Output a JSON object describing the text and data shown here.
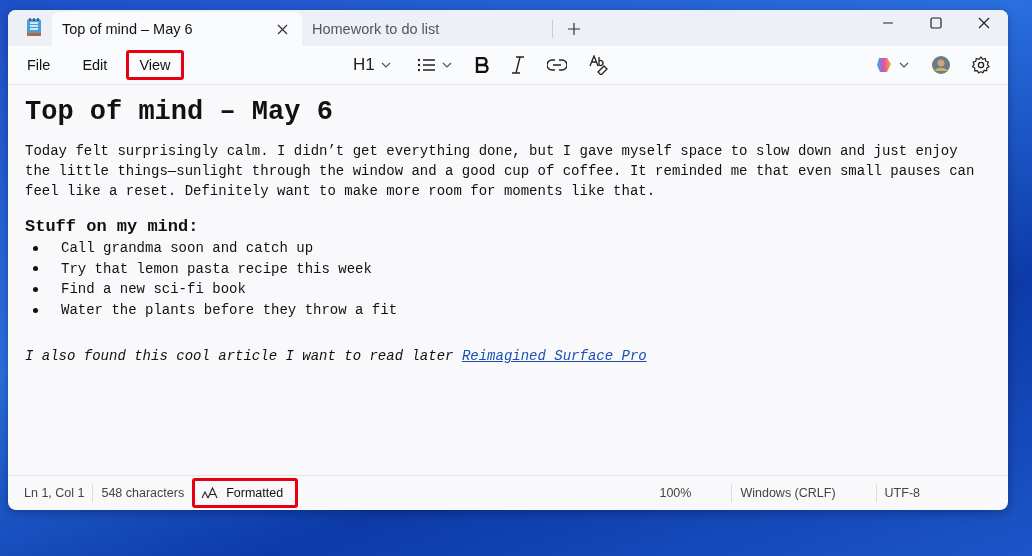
{
  "window": {
    "tabs": [
      {
        "label": "Top of mind – May 6",
        "selected": true
      },
      {
        "label": "Homework to do list",
        "selected": false
      }
    ]
  },
  "menu": [
    {
      "label": "File",
      "highlighted": false
    },
    {
      "label": "Edit",
      "highlighted": false
    },
    {
      "label": "View",
      "highlighted": true
    }
  ],
  "toolbar": {
    "heading_level": "H1"
  },
  "document": {
    "title": "Top of mind – May 6",
    "blocks": [
      {
        "kind": "paragraph",
        "text": "Today felt surprisingly calm. I didn’t get everything done, but I gave myself space to slow down and just enjoy the little things—sunlight through the window and a good cup of coffee. It reminded me that even small pauses can feel like a reset. Definitely want to make more room for moments like that."
      },
      {
        "kind": "heading",
        "text": "Stuff on my mind:"
      },
      {
        "kind": "list",
        "items": [
          "Call grandma soon and catch up",
          "Try that lemon pasta recipe this week",
          "Find a new sci-fi book",
          "Water the plants before they throw a fit"
        ]
      },
      {
        "kind": "note",
        "text": "I also found this cool article I want to read later",
        "link": "Reimagined Surface Pro"
      }
    ]
  },
  "status_bar": {
    "left": [
      {
        "kind": "text",
        "text": "Ln 1, Col 1",
        "highlighted": false
      },
      {
        "kind": "text",
        "text": "548 characters",
        "highlighted": false
      },
      {
        "kind": "format",
        "text": "Formatted",
        "highlighted": true
      }
    ],
    "right": [
      {
        "kind": "text",
        "text": "100%",
        "highlighted": false
      },
      {
        "kind": "text",
        "text": "Windows (CRLF)",
        "highlighted": false
      },
      {
        "kind": "text",
        "text": "UTF-8",
        "highlighted": false
      }
    ]
  }
}
